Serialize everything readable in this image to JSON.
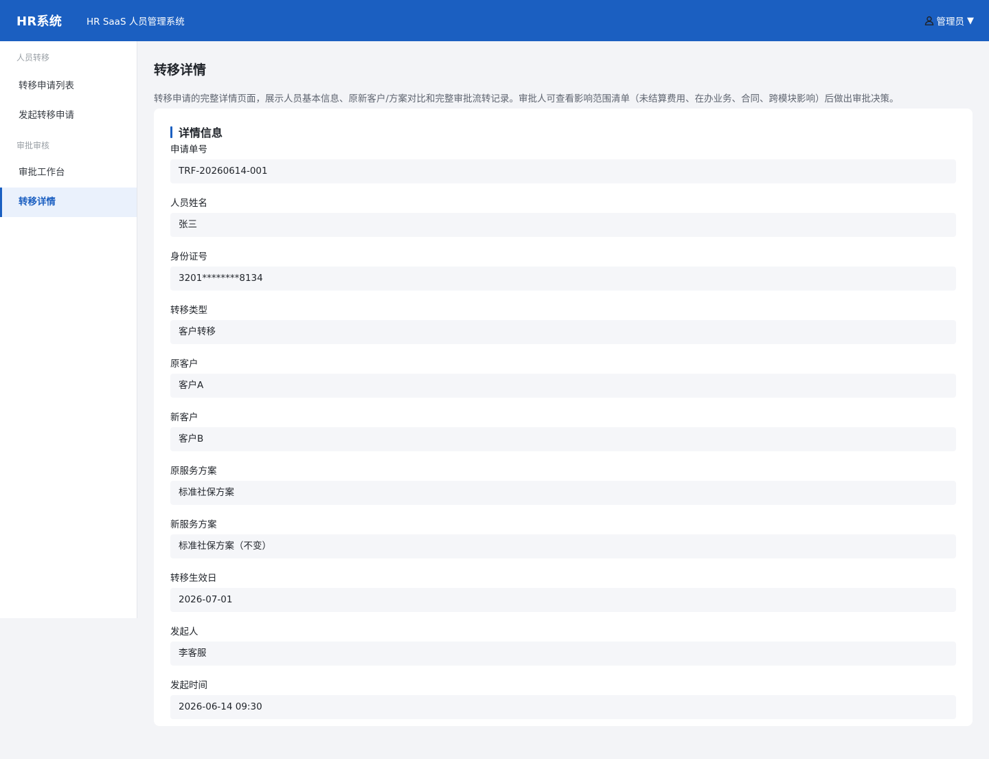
{
  "header": {
    "brand": "HR系统",
    "subtitle": "HR SaaS 人员管理系统",
    "user": "管理员",
    "user_icon": "user-icon",
    "caret": "▼"
  },
  "sidebar": {
    "groups": [
      {
        "label": "人员转移",
        "items": [
          {
            "label": "转移申请列表",
            "active": false
          },
          {
            "label": "发起转移申请",
            "active": false
          }
        ]
      },
      {
        "label": "审批审核",
        "items": [
          {
            "label": "审批工作台",
            "active": false
          },
          {
            "label": "转移详情",
            "active": true
          }
        ]
      }
    ]
  },
  "main": {
    "title": "转移详情",
    "description": "转移申请的完整详情页面，展示人员基本信息、原新客户/方案对比和完整审批流转记录。审批人可查看影响范围清单（未结算费用、在办业务、合同、跨模块影响）后做出审批决策。",
    "card_title": "详情信息",
    "fields": [
      {
        "label": "申请单号",
        "value": "TRF-20260614-001"
      },
      {
        "label": "人员姓名",
        "value": "张三"
      },
      {
        "label": "身份证号",
        "value": "3201********8134"
      },
      {
        "label": "转移类型",
        "value": "客户转移"
      },
      {
        "label": "原客户",
        "value": "客户A"
      },
      {
        "label": "新客户",
        "value": "客户B"
      },
      {
        "label": "原服务方案",
        "value": "标准社保方案"
      },
      {
        "label": "新服务方案",
        "value": "标准社保方案（不变）"
      },
      {
        "label": "转移生效日",
        "value": "2026-07-01"
      },
      {
        "label": "发起人",
        "value": "李客服"
      },
      {
        "label": "发起时间",
        "value": "2026-06-14 09:30"
      }
    ]
  },
  "colors": {
    "primary": "#1b5fc1",
    "active_bg": "#eaf1fc",
    "page_bg": "#f3f4f7",
    "field_bg": "#f5f6f9"
  }
}
